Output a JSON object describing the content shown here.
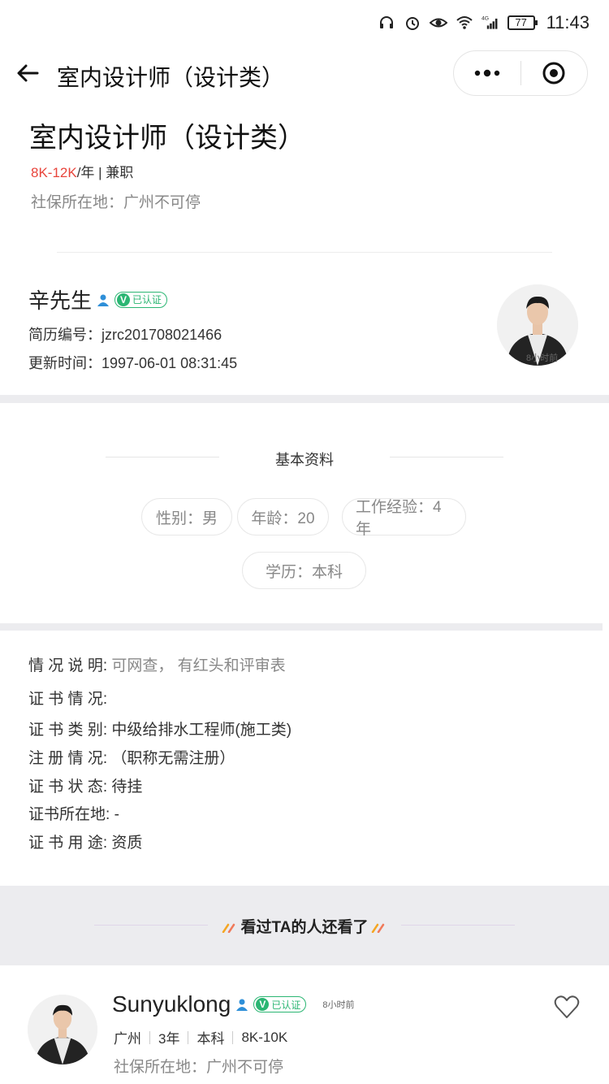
{
  "status_bar": {
    "battery": "77",
    "time": "11:43",
    "network": "4G"
  },
  "nav": {
    "title": "室内设计师（设计类）"
  },
  "job": {
    "title": "室内设计师（设计类）",
    "salary": "8K-12K",
    "salary_unit": "/年 | 兼职",
    "location": "社保所在地：广州不可停"
  },
  "person": {
    "name": "辛先生",
    "verified_label": "已认证",
    "resume_no": "简历编号：jzrc201708021466",
    "update_time": "更新时间：1997-06-01 08:31:45",
    "avatar_tag": "8小时前"
  },
  "basic": {
    "title": "基本资料",
    "gender": "性别：男",
    "age": "年龄：20",
    "experience": "工作经验：4年",
    "education": "学历：本科"
  },
  "details": {
    "situation_label": "情 况 说 明:",
    "situation_value": "可网查，  有红头和评审表",
    "cert_label": "证 书 情 况:",
    "cert_type_label": "证 书 类 别:",
    "cert_type_value": "中级给排水工程师(施工类)",
    "register_label": "注 册 情 况:",
    "register_value": "（职称无需注册）",
    "status_label": "证 书 状 态:",
    "status_value": "待挂",
    "location_label": "证书所在地:",
    "location_value": "-",
    "use_label": "证 书 用 途:",
    "use_value": "资质"
  },
  "also_viewed": {
    "title": "看过TA的人还看了",
    "card": {
      "name": "Sunyuklong",
      "verified_label": "已认证",
      "time": "8小时前",
      "city": "广州",
      "years": "3年",
      "education": "本科",
      "salary": "8K-10K",
      "location": "社保所在地：广州不可停"
    }
  },
  "colors": {
    "salary": "#e8453c",
    "verified": "#2bb673",
    "band": "#ececef"
  }
}
